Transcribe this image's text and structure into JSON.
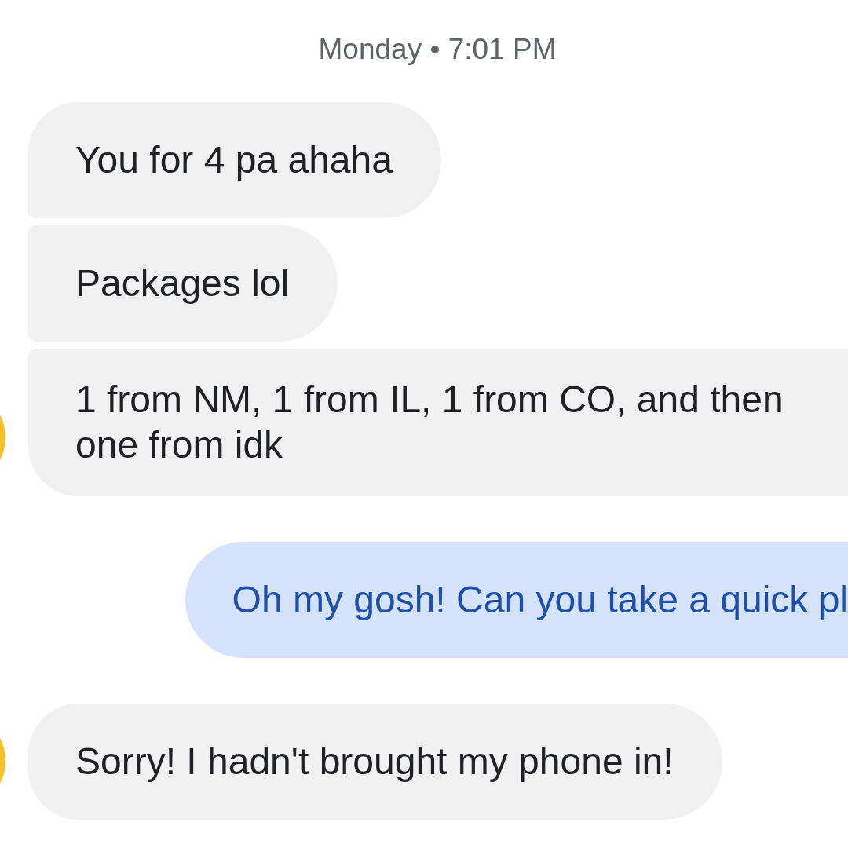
{
  "timestamp": "Monday • 7:01 PM",
  "messages": [
    {
      "kind": "incoming",
      "text": "You for 4 pa ahaha",
      "avatar": false,
      "clipped": false
    },
    {
      "kind": "incoming",
      "text": "Packages lol",
      "avatar": false,
      "clipped": false
    },
    {
      "kind": "incoming",
      "text": "1 from NM, 1 from IL, 1 from CO, and then one from idk",
      "avatar": true,
      "clipped": true
    },
    {
      "kind": "outgoing",
      "text": "Oh my gosh! Can you take a quick pl",
      "clipped": true
    },
    {
      "kind": "incoming",
      "text": "Sorry! I hadn't brought my phone in!",
      "avatar": true,
      "clipped": false
    }
  ]
}
